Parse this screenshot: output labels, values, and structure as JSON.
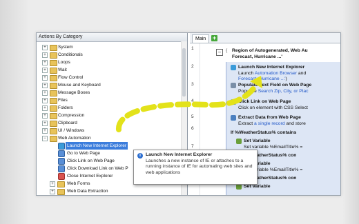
{
  "left_panel": {
    "title": "Actions By Category",
    "items": [
      {
        "label": "System",
        "kind": "folder",
        "expander": "+"
      },
      {
        "label": "Conditionals",
        "kind": "folder",
        "expander": "+"
      },
      {
        "label": "Loops",
        "kind": "folder",
        "expander": "+"
      },
      {
        "label": "Wait",
        "kind": "folder",
        "expander": "+"
      },
      {
        "label": "Flow Control",
        "kind": "folder",
        "expander": "+"
      },
      {
        "label": "Mouse and Keyboard",
        "kind": "folder",
        "expander": "+"
      },
      {
        "label": "Message Boxes",
        "kind": "folder",
        "expander": "+"
      },
      {
        "label": "Files",
        "kind": "folder",
        "expander": "+"
      },
      {
        "label": "Folders",
        "kind": "folder",
        "expander": "+"
      },
      {
        "label": "Compression",
        "kind": "folder",
        "expander": "+"
      },
      {
        "label": "Clipboard",
        "kind": "folder",
        "expander": "+"
      },
      {
        "label": "UI / Windows",
        "kind": "folder",
        "expander": "+"
      },
      {
        "label": "Web Automation",
        "kind": "folder",
        "expander": "−"
      },
      {
        "label": "Launch New Internet Explorer",
        "kind": "action",
        "selected": true
      },
      {
        "label": "Go to Web Page",
        "kind": "action"
      },
      {
        "label": "Click Link on Web Page",
        "kind": "action"
      },
      {
        "label": "Click Download Link on Web P",
        "kind": "action"
      },
      {
        "label": "Close Internet Explorer",
        "kind": "action"
      },
      {
        "label": "Web Forms",
        "kind": "folder",
        "expander": "+"
      },
      {
        "label": "Web Data Extraction",
        "kind": "folder",
        "expander": "+"
      }
    ]
  },
  "tabs": {
    "main": "Main",
    "add": "+"
  },
  "editor": {
    "line_numbers": [
      "1",
      "2",
      "3",
      "4",
      "5",
      "6",
      "7",
      "8"
    ],
    "collapse_symbol": "−",
    "region_title": "Region of Autogenerated, Web Au",
    "region_subtitle": "Forecast, Hurricane ...'",
    "steps": [
      {
        "title": "Launch New Internet Explorer",
        "desc_pre": "Launch ",
        "desc_link": "Automation Browser",
        "desc_post": " and",
        "desc2_link": "Forecast, Hurricane ...'",
        "desc2_post": ")"
      },
      {
        "title": "Populate Text Field on Web Page",
        "desc_pre": "Populate ",
        "desc_link": "Search Zip, City, or Plac",
        "desc_post": ""
      },
      {
        "title": "Click Link on Web Page",
        "desc_pre": "Click on element with CSS Select",
        "desc_link": "",
        "desc_post": ""
      },
      {
        "title": "Extract Data from Web Page",
        "desc_pre": "Extract ",
        "desc_link": "a single record",
        "desc_post": " and store"
      },
      {
        "title": "If %WeatherStatus% contains",
        "desc_pre": "",
        "desc_link": "",
        "desc_post": ""
      },
      {
        "title": "Set Variable",
        "desc_pre": "Set variable %EmailTitle% =",
        "desc_link": "",
        "desc_post": ""
      },
      {
        "title": "Else If %WeatherStatus% con",
        "desc_pre": "",
        "desc_link": "",
        "desc_post": ""
      },
      {
        "title": "Set Variable",
        "desc_pre": "Set variable %EmailTitle% =",
        "desc_link": "",
        "desc_post": ""
      },
      {
        "title": "Else If %WeatherStatus% con",
        "desc_pre": "",
        "desc_link": "",
        "desc_post": ""
      },
      {
        "title": "Set Variable",
        "desc_pre": "",
        "desc_link": "",
        "desc_post": ""
      }
    ]
  },
  "tooltip": {
    "title": "Launch New Internet Explorer",
    "body": "Launches a new instance of IE or attaches to a running instance of IE for automating web sites and web applications"
  },
  "colors": {
    "arrow": "#e3e21a",
    "selection": "#3b7ddc",
    "link": "#1f56c7",
    "folder": "#e8c35a"
  }
}
